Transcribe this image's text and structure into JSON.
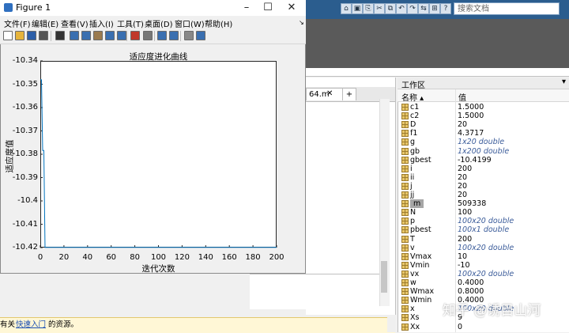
{
  "figure": {
    "title": "Figure 1",
    "window_buttons": [
      "–",
      "☐",
      "✕"
    ],
    "menu": [
      "文件(F)",
      "编辑(E)",
      "查看(V)",
      "插入(I)",
      "工具(T)",
      "桌面(D)",
      "窗口(W)",
      "帮助(H)"
    ],
    "toolbar_icons": [
      "new-file-icon",
      "open-folder-icon",
      "save-icon",
      "print-icon",
      "pointer-icon",
      "zoom-in-icon",
      "zoom-out-icon",
      "pan-icon",
      "rotate-icon",
      "data-cursor-icon",
      "brush-icon",
      "link-icon",
      "colorbar-icon",
      "legend-icon",
      "hide-plot-tools-icon",
      "show-plot-tools-icon"
    ]
  },
  "chart_data": {
    "type": "line",
    "title": "适应度进化曲线",
    "xlabel": "迭代次数",
    "ylabel": "适应度值",
    "xlim": [
      0,
      200
    ],
    "ylim": [
      -10.42,
      -10.34
    ],
    "xticks": [
      "0",
      "20",
      "40",
      "60",
      "80",
      "100",
      "120",
      "140",
      "160",
      "180",
      "200"
    ],
    "yticks": [
      "-10.34",
      "-10.35",
      "-10.36",
      "-10.37",
      "-10.38",
      "-10.39",
      "-10.4",
      "-10.41",
      "-10.42"
    ],
    "series": [
      {
        "color": "#0072bd",
        "x": [
          0,
          1,
          2,
          3,
          4,
          5,
          200
        ],
        "y": [
          -10.3481,
          -10.3481,
          -10.3784,
          -10.3784,
          -10.4199,
          -10.4199,
          -10.4199
        ]
      }
    ],
    "grid": false
  },
  "matlab": {
    "search_placeholder": "搜索文档",
    "quick_buttons": [
      "⌂",
      "▣",
      "⎘",
      "✂",
      "⧉",
      "↶",
      "↷",
      "⇆",
      "⊞",
      "?"
    ],
    "editor_tab": "64.m",
    "editor_tab_close": "✕",
    "editor_tab_add": "+"
  },
  "workspace": {
    "title": "工作区",
    "col_name": "名称 ▴",
    "col_value": "值",
    "rows": [
      {
        "name": "c1",
        "value": "1.5000",
        "italic": false
      },
      {
        "name": "c2",
        "value": "1.5000",
        "italic": false
      },
      {
        "name": "D",
        "value": "20",
        "italic": false
      },
      {
        "name": "f1",
        "value": "4.3717",
        "italic": false
      },
      {
        "name": "g",
        "value": "1x20 double",
        "italic": true
      },
      {
        "name": "gb",
        "value": "1x200 double",
        "italic": true
      },
      {
        "name": "gbest",
        "value": "-10.4199",
        "italic": false
      },
      {
        "name": "i",
        "value": "200",
        "italic": false
      },
      {
        "name": "ii",
        "value": "20",
        "italic": false
      },
      {
        "name": "j",
        "value": "20",
        "italic": false
      },
      {
        "name": "jj",
        "value": "20",
        "italic": false
      },
      {
        "name": "m",
        "value": "509338",
        "italic": false
      },
      {
        "name": "N",
        "value": "100",
        "italic": false
      },
      {
        "name": "p",
        "value": "100x20 double",
        "italic": true
      },
      {
        "name": "pbest",
        "value": "100x1 double",
        "italic": true
      },
      {
        "name": "T",
        "value": "200",
        "italic": false
      },
      {
        "name": "v",
        "value": "100x20 double",
        "italic": true
      },
      {
        "name": "Vmax",
        "value": "10",
        "italic": false
      },
      {
        "name": "Vmin",
        "value": "-10",
        "italic": false
      },
      {
        "name": "vx",
        "value": "100x20 double",
        "italic": true
      },
      {
        "name": "w",
        "value": "0.4000",
        "italic": false
      },
      {
        "name": "Wmax",
        "value": "0.8000",
        "italic": false
      },
      {
        "name": "Wmin",
        "value": "0.4000",
        "italic": false
      },
      {
        "name": "x",
        "value": "100x20 double",
        "italic": true
      },
      {
        "name": "Xs",
        "value": "9",
        "italic": false
      },
      {
        "name": "Xx",
        "value": "0",
        "italic": false
      }
    ]
  },
  "status": {
    "prefix": "有关",
    "link": "快速入门",
    "suffix": "的资源。"
  },
  "watermark": "知乎 @诱目山河"
}
